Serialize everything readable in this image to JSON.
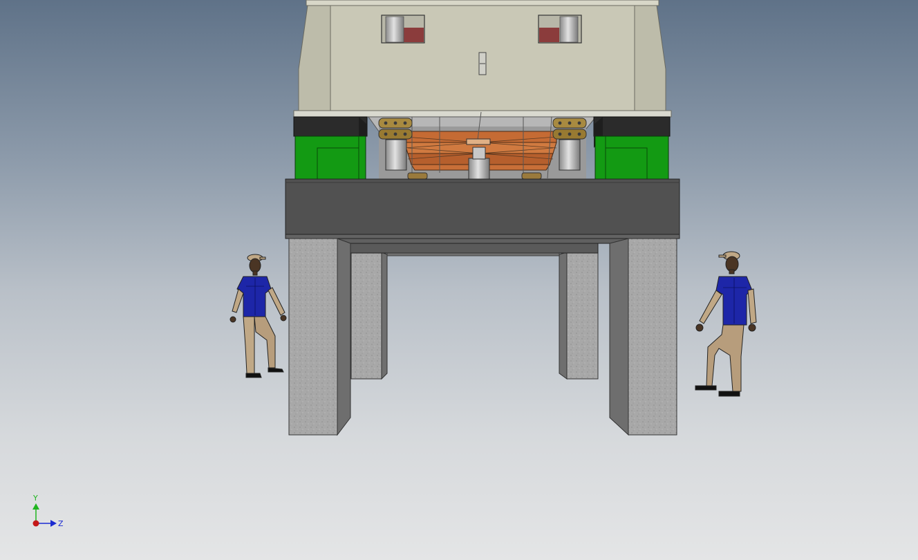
{
  "viewport": {
    "colors": {
      "background_top": "#5f7288",
      "background_bottom": "#e4e5e6",
      "housing": "#c9c8b6",
      "green_block": "#139a13",
      "copper_plates": "#c26a33",
      "beam": "#515151",
      "concrete": "#a9a9a9",
      "figure_shirt": "#1d26a8",
      "figure_pants": "#c0a886"
    }
  },
  "triad": {
    "y_label": "Y",
    "z_label": "Z",
    "icons": [
      "axis-y-arrow-icon",
      "axis-z-arrow-icon",
      "axis-x-dot-icon"
    ],
    "colors": {
      "y": "#1fb51f",
      "z": "#1b2bd1",
      "x": "#c41818"
    }
  }
}
